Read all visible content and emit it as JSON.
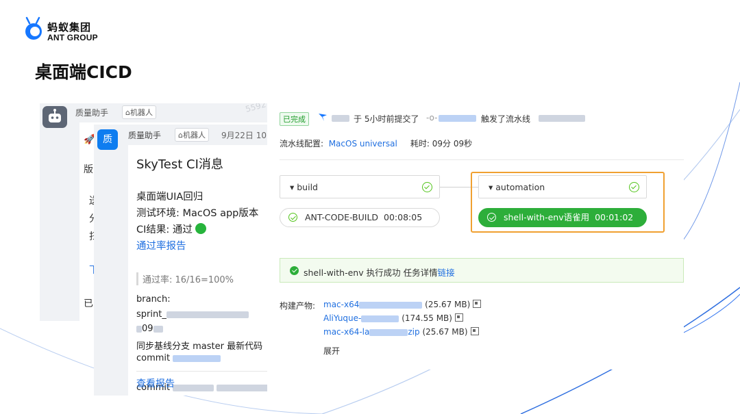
{
  "logo": {
    "cn": "蚂蚁集团",
    "en": "ANT GROUP"
  },
  "page_title": "桌面端CICD",
  "chat_back": {
    "sender": "质量助手",
    "tag": "机器人",
    "watermark": "5592",
    "fragments": [
      "版",
      "送",
      "分",
      "扫",
      "下",
      "已"
    ]
  },
  "chat_front": {
    "avatar_char": "质",
    "sender": "质量助手",
    "tag": "机器人",
    "date": "9月22日 10",
    "message": {
      "title": "SkyTest CI消息",
      "line1": "桌面端UIA回归",
      "line2": "测试环境: MacOS app版本",
      "line3": "CI结果: 通过",
      "report_link": "通过率报告",
      "pass_rate": "通过率: 16/16=100%",
      "branch_label": "branch:",
      "branch_value": "sprint_",
      "branch_tail": "09",
      "sync": "同步基线分支 master 最新代码",
      "commit1": "commit",
      "commit2": "commit",
      "view_report": "查看报告"
    }
  },
  "pipeline": {
    "status": "已完成",
    "header_middle": "于 5小时前提交了",
    "header_end": "触发了流水线",
    "config_label": "流水线配置:",
    "config_value": "MacOS universal",
    "duration_label": "耗时:",
    "duration_value": "09分 09秒",
    "stages": [
      {
        "name": "build",
        "job": "ANT-CODE-BUILD",
        "time": "00:08:05",
        "status": "success"
      },
      {
        "name": "automation",
        "job": "shell-with-env语雀用",
        "time": "00:01:02",
        "status": "success"
      }
    ],
    "banner": {
      "text": "shell-with-env 执行成功 任务详情",
      "link": "链接"
    },
    "artifacts_label": "构建产物:",
    "artifacts": [
      {
        "name": "mac-x64",
        "size": "(25.67 MB)"
      },
      {
        "name": "AliYuque-",
        "size": "(174.55 MB)"
      },
      {
        "name": "mac-x64-la",
        "ext": "zip",
        "size": "(25.67 MB)"
      }
    ],
    "expand": "展开"
  },
  "colors": {
    "accent": "#1f6fe0",
    "success": "#2dae3a",
    "highlight": "#f0a030"
  }
}
